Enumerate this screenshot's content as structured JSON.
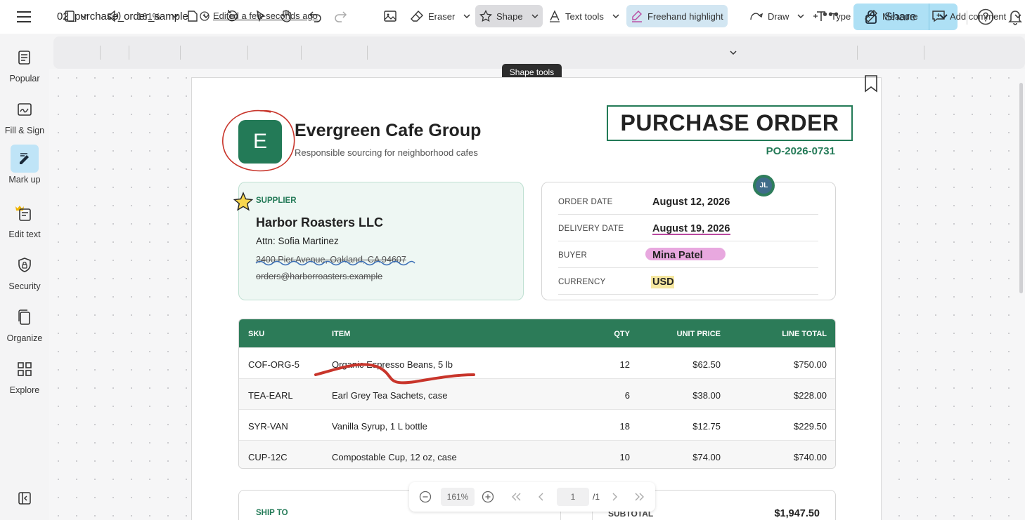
{
  "header": {
    "file_name": "02_purchase_order_sample",
    "edited_status": "Edited a few seconds ago",
    "share_label": "Share"
  },
  "sidebar": {
    "items": [
      {
        "label": "Popular",
        "icon": "popular-icon"
      },
      {
        "label": "Fill & Sign",
        "icon": "fill-sign-icon"
      },
      {
        "label": "Mark up",
        "icon": "markup-icon",
        "active": true
      },
      {
        "label": "Edit text",
        "icon": "edit-text-icon"
      },
      {
        "label": "Security",
        "icon": "shield-icon"
      },
      {
        "label": "Organize",
        "icon": "organize-icon"
      },
      {
        "label": "Explore",
        "icon": "grid-icon"
      }
    ]
  },
  "toolbar": {
    "zoom": "161%",
    "eraser_label": "Eraser",
    "shape_label": "Shape",
    "text_tools_label": "Text tools",
    "freehand_label": "Freehand highlight",
    "draw_label": "Draw",
    "type_label": "Type",
    "measure_label": "Measure",
    "add_comment_label": "Add comment",
    "tooltip": "Shape tools"
  },
  "document": {
    "logo_letter": "E",
    "company": "Evergreen Cafe Group",
    "tagline": "Responsible sourcing for neighborhood cafes",
    "doc_title": "PURCHASE ORDER",
    "po_number": "PO-2026-0731",
    "supplier": {
      "label": "SUPPLIER",
      "name": "Harbor Roasters LLC",
      "attn": "Attn: Sofia Martinez",
      "address": "2400 Pier Avenue, Oakland, CA 94607",
      "email": "orders@harborroasters.example"
    },
    "order": {
      "order_date_label": "ORDER DATE",
      "order_date": "August 12, 2026",
      "delivery_date_label": "DELIVERY DATE",
      "delivery_date": "August 19, 2026",
      "buyer_label": "BUYER",
      "buyer": "Mina Patel",
      "currency_label": "CURRENCY",
      "currency": "USD"
    },
    "comment_avatar": "JL",
    "table": {
      "headers": {
        "sku": "SKU",
        "item": "ITEM",
        "qty": "QTY",
        "unit_price": "UNIT PRICE",
        "line_total": "LINE TOTAL"
      },
      "rows": [
        {
          "sku": "COF-ORG-5",
          "item": "Organic Espresso Beans, 5 lb",
          "qty": "12",
          "unit_price": "$62.50",
          "line_total": "$750.00"
        },
        {
          "sku": "TEA-EARL",
          "item": "Earl Grey Tea Sachets, case",
          "qty": "6",
          "unit_price": "$38.00",
          "line_total": "$228.00"
        },
        {
          "sku": "SYR-VAN",
          "item": "Vanilla Syrup, 1 L bottle",
          "qty": "18",
          "unit_price": "$12.75",
          "line_total": "$229.50"
        },
        {
          "sku": "CUP-12C",
          "item": "Compostable Cup, 12 oz, case",
          "qty": "10",
          "unit_price": "$74.00",
          "line_total": "$740.00"
        }
      ]
    },
    "ship_to_label": "SHIP TO",
    "subtotal_label": "SUBTOTAL",
    "subtotal": "$1,947.50"
  },
  "pager": {
    "zoom": "161%",
    "page": "1",
    "total": "/1"
  },
  "colors": {
    "brand_green": "#237a57",
    "share_blue": "#aee0f5",
    "annotation_red": "#c8352b",
    "buyer_highlight": "#e8a8df",
    "currency_highlight": "#f6e7a0"
  }
}
